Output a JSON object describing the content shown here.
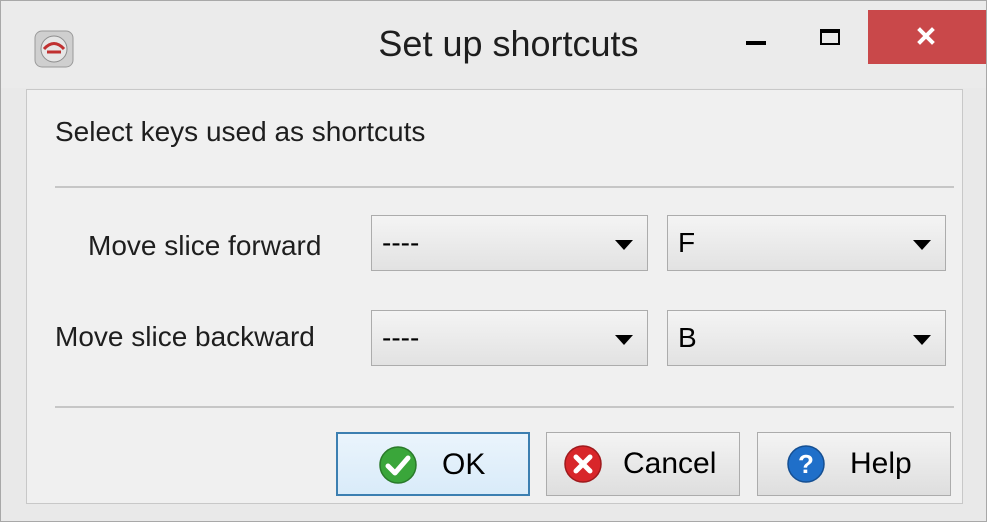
{
  "window": {
    "title": "Set up shortcuts",
    "controls": {
      "minimize": "minimize",
      "maximize": "maximize",
      "close": "close"
    }
  },
  "dialog": {
    "header": "Select keys used as shortcuts",
    "rows": [
      {
        "label": "Move slice forward",
        "modifier": "----",
        "key": "F"
      },
      {
        "label": "Move slice backward",
        "modifier": "----",
        "key": "B"
      }
    ]
  },
  "buttons": {
    "ok": "OK",
    "cancel": "Cancel",
    "help": "Help"
  },
  "colors": {
    "close_button": "#c9484a",
    "ok_border": "#3c7fb1",
    "ok_icon": "#3aa63a",
    "cancel_icon": "#d8262a",
    "help_icon": "#1f6fc9"
  }
}
